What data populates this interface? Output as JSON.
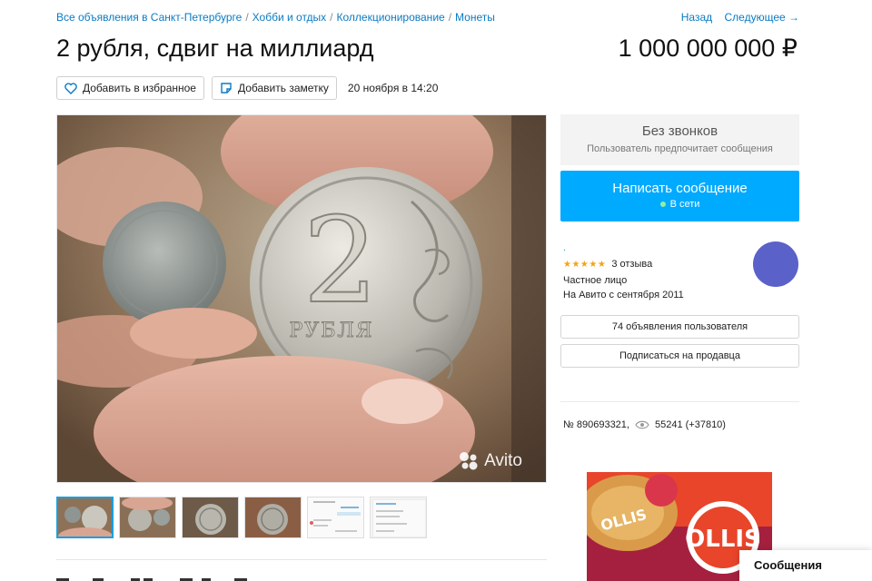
{
  "breadcrumb": {
    "items": [
      "Все объявления в Санкт-Петербурге",
      "Хобби и отдых",
      "Коллекционирование",
      "Монеты"
    ],
    "separator": "/"
  },
  "topnav": {
    "back": "Назад",
    "next": "Следующее →"
  },
  "listing": {
    "title": "2 рубля, сдвиг на миллиард",
    "price": "1 000 000 000 ₽",
    "add_favorite": "Добавить в избранное",
    "add_note": "Добавить заметку",
    "date": "20 ноября в 14:20"
  },
  "photo": {
    "watermark": "Avito",
    "coin_numeral": "2",
    "coin_text": "РУБЛЯ"
  },
  "contact": {
    "no_calls_title": "Без звонков",
    "no_calls_sub": "Пользователь предпочитает сообщения",
    "write_button": "Написать сообщение",
    "online_status": "В сети"
  },
  "seller": {
    "rating_stars": "★★★★★",
    "reviews": "3 отзыва",
    "type": "Частное лицо",
    "since": "На Авито с сентября 2011",
    "listings_button": "74 объявления пользователя",
    "subscribe_button": "Подписаться на продавца",
    "avatar_color": "#5a61c9"
  },
  "stats": {
    "listing_number": "№ 890693321,",
    "views": "55241 (+37810)"
  },
  "ad": {
    "brand": "OLLIS"
  },
  "messages_tab": "Сообщения",
  "colors": {
    "accent": "#00aaff",
    "link": "#0a7bc4",
    "star": "#f6a313"
  }
}
